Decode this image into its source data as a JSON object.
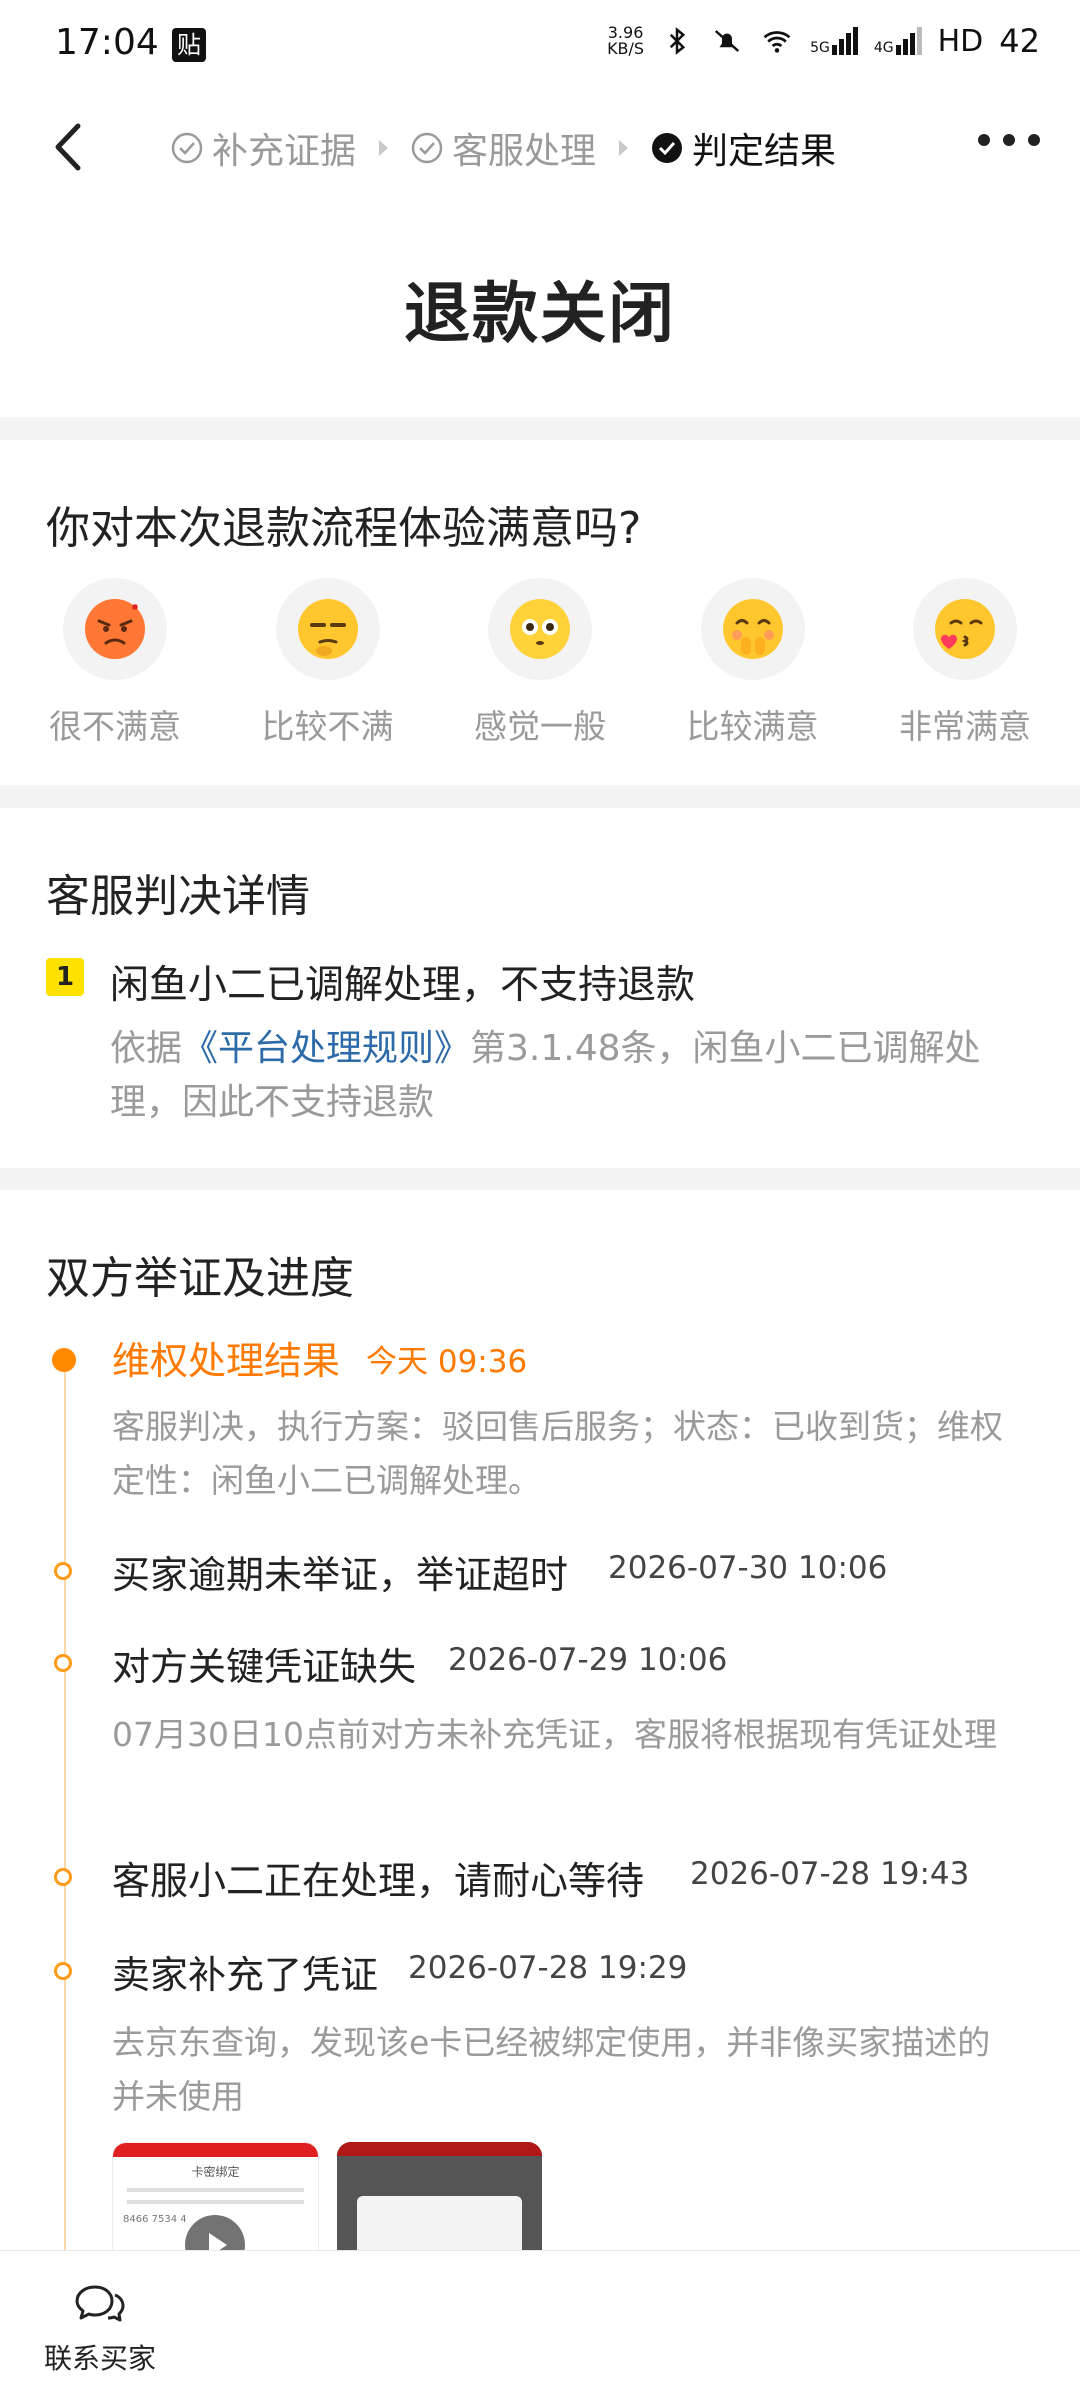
{
  "status_bar": {
    "time": "17:04",
    "badge": "贴",
    "net_speed_top": "3.96",
    "net_speed_bottom": "KB/S",
    "sig1": "5G",
    "sig2": "4G",
    "hd": "HD",
    "battery": "42"
  },
  "nav": {
    "steps": [
      "补充证据",
      "客服处理",
      "判定结果"
    ],
    "active_step": "判定结果"
  },
  "hero": {
    "title": "退款关闭"
  },
  "satisfaction": {
    "title": "你对本次退款流程体验满意吗?",
    "options": [
      {
        "label": "很不满意",
        "icon": "angry-face-icon"
      },
      {
        "label": "比较不满",
        "icon": "unamused-face-icon"
      },
      {
        "label": "感觉一般",
        "icon": "flushed-face-icon"
      },
      {
        "label": "比较满意",
        "icon": "shy-face-icon"
      },
      {
        "label": "非常满意",
        "icon": "kissing-face-icon"
      }
    ]
  },
  "verdict": {
    "title": "客服判决详情",
    "number": "1",
    "headline": "闲鱼小二已调解处理，不支持退款",
    "desc_prefix": "依据",
    "desc_link": "《平台处理规则》",
    "desc_suffix": "第3.1.48条，闲鱼小二已调解处理，因此不支持退款"
  },
  "progress": {
    "title": "双方举证及进度",
    "events": [
      {
        "title": "维权处理结果",
        "time": "今天 09:36",
        "desc": "客服判决，执行方案：驳回售后服务；状态：已收到货；维权定性：闲鱼小二已调解处理。"
      },
      {
        "title": "买家逾期未举证，举证超时",
        "time": "2026-07-30 10:06",
        "desc": ""
      },
      {
        "title": "对方关键凭证缺失",
        "time": "2026-07-29 10:06",
        "desc": "07月30日10点前对方未补充凭证，客服将根据现有凭证处理"
      },
      {
        "title": "客服小二正在处理，请耐心等待",
        "time": "2026-07-28 19:43",
        "desc": ""
      },
      {
        "title": "卖家补充了凭证",
        "time": "2026-07-28 19:29",
        "desc": "去京东查询，发现该e卡已经被绑定使用，并非像买家描述的并未使用"
      }
    ],
    "thumb1_caption": "卡密绑定",
    "thumb1_code": "8466 7534 4"
  },
  "bottom": {
    "contact_label": "联系买家"
  },
  "colors": {
    "accent": "#ff7a00",
    "link": "#2d6aa8",
    "badge": "#ffe100"
  }
}
